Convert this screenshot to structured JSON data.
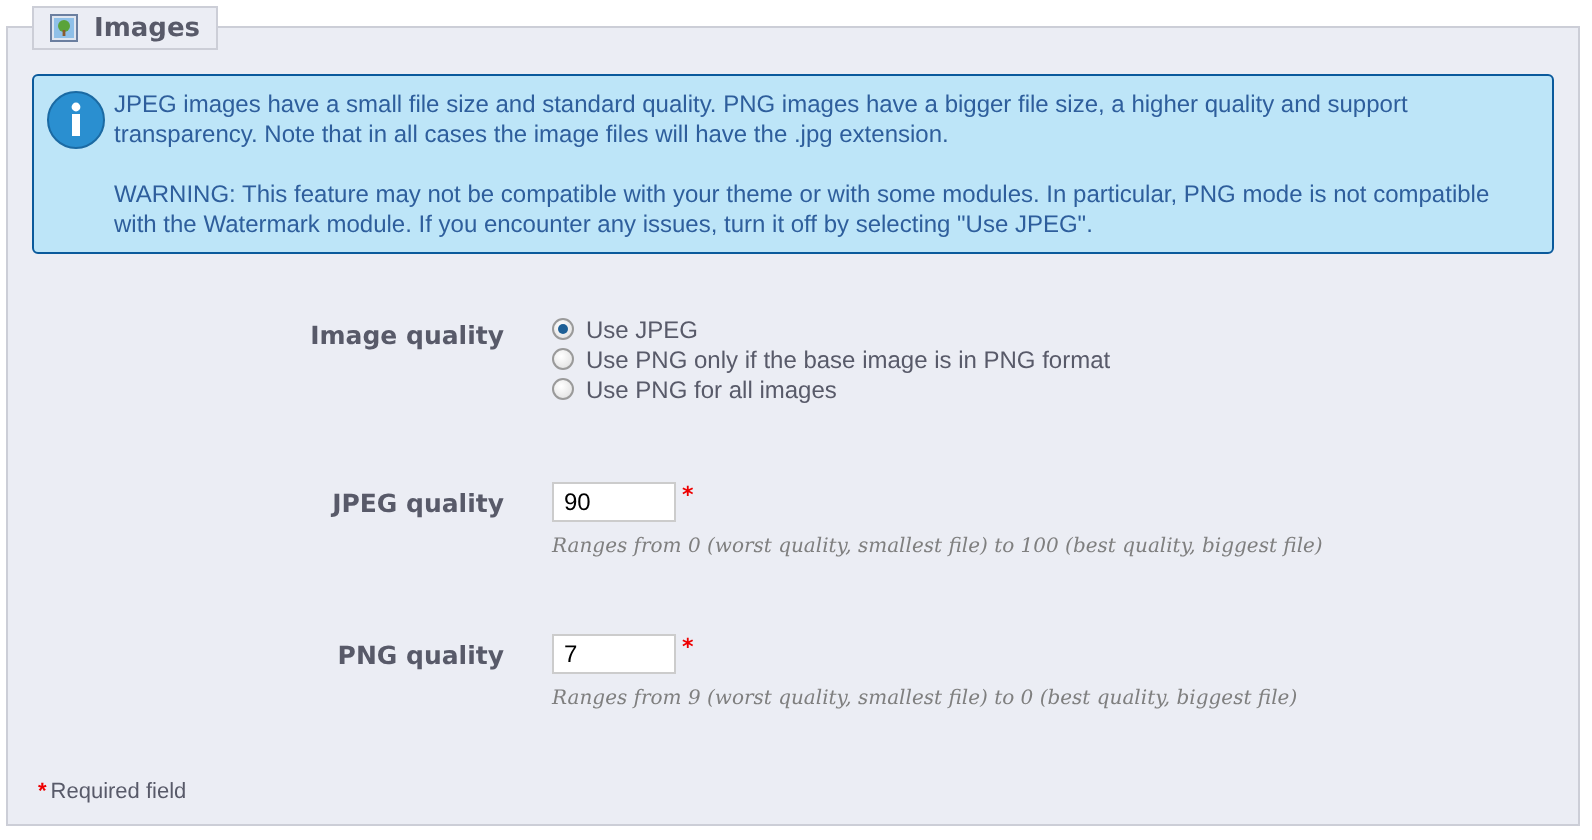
{
  "panel": {
    "title": "Images"
  },
  "info": {
    "paragraphs": [
      "JPEG images have a small file size and standard quality. PNG images have a bigger file size, a higher quality and support transparency. Note that in all cases the image files will have the .jpg extension.",
      "WARNING: This feature may not be compatible with your theme or with some modules. In particular, PNG mode is not compatible with the Watermark module. If you encounter any issues, turn it off by selecting \"Use JPEG\"."
    ]
  },
  "image_quality": {
    "label": "Image quality",
    "options": [
      {
        "label": "Use JPEG",
        "selected": true
      },
      {
        "label": "Use PNG only if the base image is in PNG format",
        "selected": false
      },
      {
        "label": "Use PNG for all images",
        "selected": false
      }
    ]
  },
  "fields": [
    {
      "label": "JPEG quality",
      "value": "90",
      "mark": "*",
      "hint": "Ranges from 0 (worst quality, smallest file) to 100 (best quality, biggest file)"
    },
    {
      "label": "PNG quality",
      "value": "7",
      "mark": "*",
      "hint": "Ranges from 9 (worst quality, smallest file) to 0 (best quality, biggest file)"
    }
  ],
  "footer": {
    "mark": "*",
    "text": "Required field"
  }
}
